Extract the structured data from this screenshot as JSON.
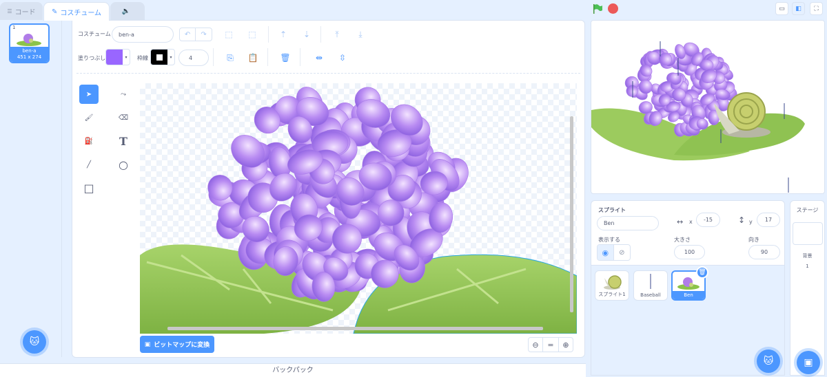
{
  "tabs": {
    "code": "コード",
    "costumes": "コスチューム",
    "sounds": ""
  },
  "costume_list": {
    "items": [
      {
        "number": "1",
        "name": "ben-a",
        "size": "451 x 274"
      }
    ]
  },
  "editor": {
    "costume_label": "コスチューム",
    "costume_name": "ben-a",
    "fill_label": "塗りつぶし",
    "outline_label": "枠線",
    "outline_width": "4",
    "fill_color": "#9966ff",
    "outline_color": "#000000",
    "convert_button": "ビットマップに変換",
    "zoom_reset": "="
  },
  "backpack": {
    "label": "バックパック"
  },
  "sprite_info": {
    "sprite_label": "スプライト",
    "sprite_name": "Ben",
    "x_label": "x",
    "x_value": "-15",
    "y_label": "y",
    "y_value": "17",
    "show_label": "表示する",
    "size_label": "大きさ",
    "size_value": "100",
    "direction_label": "向き",
    "direction_value": "90"
  },
  "sprites": [
    {
      "name": "スプライト1"
    },
    {
      "name": "Baseball"
    },
    {
      "name": "Ben"
    }
  ],
  "stage_pane": {
    "title": "ステージ",
    "backdrops_label": "背景",
    "backdrops_count": "1"
  }
}
